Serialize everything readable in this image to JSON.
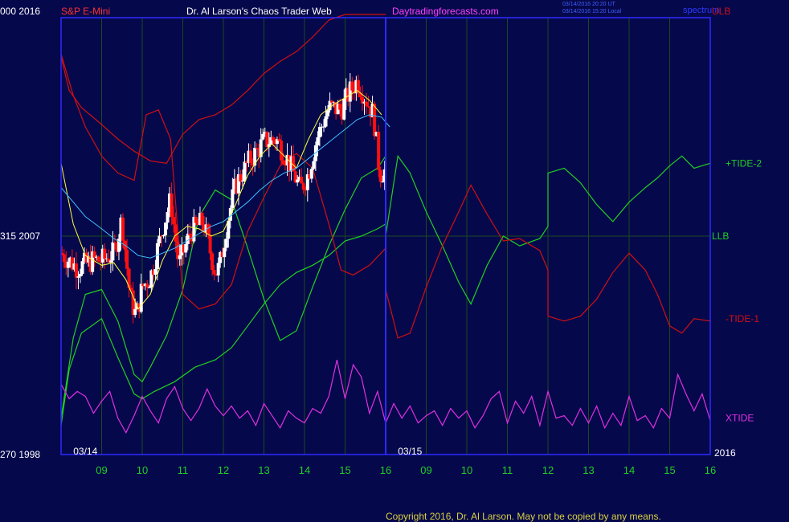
{
  "header": {
    "symbol": "S&P E-Mini",
    "author": "Dr. Al Larson's Chaos Trader Web",
    "site": "Daytradingforecasts.com",
    "timestamp_ut": "03/14/2016 20:20 UT",
    "timestamp_local": "03/14/2016 15:20 Local",
    "watermark": "spectrum",
    "corner_left": "000 2016"
  },
  "left_axis": [
    {
      "value": 2016,
      "label": "000  2016"
    },
    {
      "value": 2007,
      "label": "315  2007"
    },
    {
      "value": 1998,
      "label": "270  1998"
    }
  ],
  "right_axis_year": "2016",
  "date_labels": [
    {
      "label": "03/14",
      "x": 8.5
    },
    {
      "label": "03/15",
      "x": 16.5
    }
  ],
  "footer": {
    "copyright": "Copyright 2016, Dr. Al Larson. May not be copied by any means."
  },
  "colors": {
    "background": "#06084c",
    "frame": "#2b2bff",
    "grid": "#1b4a1b",
    "price_up": "#ffffff",
    "price_down": "#ff1010",
    "ma_fast": "#ffff40",
    "ma_slow": "#40c0ff",
    "green_line": "#20d020",
    "red_line": "#d01010",
    "xtide": "#e030e0",
    "title_red": "#ff3030",
    "title_white": "#ffffff",
    "title_magenta": "#ff40ff",
    "axis_text": "#ffffff",
    "hour_labels": "#20d020"
  },
  "chart_data": {
    "type": "line",
    "title": "S&P E-Mini",
    "xlabel": "",
    "ylabel": "",
    "ylim": [
      1998,
      2016
    ],
    "xlim": [
      8,
      16
    ],
    "x_ticks": [
      {
        "x": 9,
        "label": "09"
      },
      {
        "x": 10,
        "label": "10"
      },
      {
        "x": 11,
        "label": "11"
      },
      {
        "x": 12,
        "label": "12"
      },
      {
        "x": 13,
        "label": "13"
      },
      {
        "x": 14,
        "label": "14"
      },
      {
        "x": 15,
        "label": "15"
      },
      {
        "x": 16,
        "label": "16"
      },
      {
        "x": 17,
        "label": "09"
      },
      {
        "x": 18,
        "label": "10"
      },
      {
        "x": 19,
        "label": "11"
      },
      {
        "x": 20,
        "label": "12"
      },
      {
        "x": 21,
        "label": "13"
      },
      {
        "x": 22,
        "label": "14"
      },
      {
        "x": 23,
        "label": "15"
      },
      {
        "x": 24,
        "label": "16"
      }
    ],
    "day_divider_x": 16.0,
    "grid": true,
    "series": [
      {
        "name": "+TIDE-2",
        "color": "#20d020",
        "x": [
          16.0,
          16.3,
          16.6,
          17.0,
          17.4,
          17.8,
          18.1,
          18.5,
          18.9,
          19.3,
          19.8,
          20.0,
          20.0,
          20.4,
          20.8,
          21.2,
          21.6,
          22.0,
          22.4,
          22.7,
          23.0,
          23.3,
          23.6,
          24.0
        ],
        "y": [
          2007.0,
          2010.3,
          2009.6,
          2008.0,
          2006.6,
          2005.1,
          2004.2,
          2005.8,
          2007.0,
          2006.6,
          2006.9,
          2007.4,
          2009.6,
          2009.8,
          2009.2,
          2008.3,
          2007.6,
          2008.4,
          2009.0,
          2009.4,
          2009.9,
          2010.3,
          2009.8,
          2010.0
        ]
      },
      {
        "name": "-TIDE-1",
        "color": "#d01010",
        "x": [
          16.0,
          16.0,
          16.3,
          16.6,
          17.0,
          17.4,
          17.8,
          18.1,
          18.5,
          18.9,
          19.3,
          19.8,
          20.0,
          20.0,
          20.4,
          20.8,
          21.2,
          21.6,
          22.0,
          22.4,
          22.7,
          23.0,
          23.3,
          23.6,
          24.0
        ],
        "y": [
          2006.2,
          2004.8,
          2002.8,
          2003.0,
          2004.9,
          2006.6,
          2008.0,
          2009.1,
          2007.9,
          2006.8,
          2006.9,
          2006.4,
          2005.6,
          2003.7,
          2003.5,
          2003.7,
          2004.4,
          2005.5,
          2006.3,
          2005.6,
          2004.6,
          2003.3,
          2003.0,
          2003.6,
          2003.5
        ]
      },
      {
        "name": "LLB",
        "color": "#20d020",
        "x": [
          8.0,
          8.3,
          8.6,
          9.0,
          9.4,
          9.8,
          10.0,
          10.2,
          10.6,
          11.0,
          11.4,
          11.8,
          12.2,
          12.6,
          13.0,
          13.4,
          13.8,
          14.2,
          14.6,
          15.0,
          15.4,
          15.8,
          16.0
        ],
        "y": [
          1999.5,
          2002.8,
          2004.6,
          2004.8,
          2003.5,
          2001.3,
          2001.0,
          2001.6,
          2002.9,
          2004.8,
          2007.8,
          2008.9,
          2008.5,
          2006.5,
          2004.4,
          2002.7,
          2003.1,
          2004.9,
          2006.6,
          2008.1,
          2009.4,
          2009.8,
          2010.3
        ]
      },
      {
        "name": "LLB",
        "color": "#20d020",
        "x": [
          8.0,
          8.2,
          8.5,
          9.0,
          9.4,
          9.8,
          10.0,
          10.3,
          10.8,
          11.3,
          11.8,
          12.2,
          12.6,
          13.0,
          13.4,
          13.8,
          14.2,
          14.6,
          15.0,
          15.4,
          15.8,
          16.0
        ],
        "y": [
          1999.2,
          2001.5,
          2003.0,
          2003.6,
          2002.0,
          2000.5,
          2000.3,
          2000.6,
          2001.0,
          2001.6,
          2001.9,
          2002.4,
          2003.3,
          2004.2,
          2005.0,
          2005.5,
          2005.8,
          2006.2,
          2006.8,
          2007.0,
          2007.3,
          2007.5
        ]
      },
      {
        "name": "ULB",
        "color": "#d01010",
        "x": [
          8.0,
          8.2,
          8.5,
          9.0,
          9.4,
          9.8,
          10.2,
          10.6,
          11.0,
          11.4,
          11.8,
          12.2,
          12.6,
          13.0,
          13.4,
          13.8,
          14.2,
          14.6,
          15.0,
          15.4,
          15.8,
          16.0
        ],
        "y": [
          2014.4,
          2013.0,
          2012.3,
          2011.6,
          2011.0,
          2010.5,
          2010.1,
          2010.0,
          2011.2,
          2011.8,
          2012.0,
          2012.4,
          2013.0,
          2013.7,
          2014.2,
          2014.6,
          2015.2,
          2015.9,
          2016.4,
          2017.2,
          2017.8,
          2018.3
        ]
      },
      {
        "name": "ULB",
        "color": "#d01010",
        "x": [
          8.0,
          8.3,
          8.6,
          9.0,
          9.4,
          9.8,
          10.1,
          10.4,
          10.7,
          11.0,
          11.4,
          11.8,
          12.2,
          12.6,
          13.0,
          13.4,
          13.8,
          14.2,
          14.6,
          14.9,
          15.2,
          15.6,
          16.0
        ],
        "y": [
          2014.5,
          2012.8,
          2011.5,
          2010.3,
          2009.6,
          2009.3,
          2012.0,
          2012.2,
          2011.0,
          2004.6,
          2004.0,
          2004.2,
          2005.0,
          2007.2,
          2008.6,
          2009.9,
          2010.4,
          2009.8,
          2007.5,
          2005.6,
          2005.4,
          2005.8,
          2006.5
        ]
      },
      {
        "name": "Moving Average",
        "color": "#ffff40",
        "x": [
          8.0,
          8.3,
          8.6,
          9.0,
          9.3,
          9.6,
          9.9,
          10.2,
          10.5,
          10.8,
          11.1,
          11.4,
          11.7,
          12.0,
          12.3,
          12.6,
          12.9,
          13.2,
          13.5,
          13.8,
          14.1,
          14.4,
          14.7,
          15.0,
          15.3,
          15.6,
          15.9
        ],
        "y": [
          2010.0,
          2007.5,
          2006.2,
          2005.8,
          2005.9,
          2005.2,
          2004.0,
          2004.6,
          2006.0,
          2007.0,
          2007.4,
          2007.3,
          2007.0,
          2007.2,
          2008.3,
          2009.5,
          2010.3,
          2010.8,
          2010.3,
          2009.8,
          2011.0,
          2012.0,
          2012.4,
          2012.7,
          2013.0,
          2012.6,
          2012.0
        ]
      },
      {
        "name": "Moving Average",
        "color": "#40c0ff",
        "x": [
          8.0,
          8.3,
          8.6,
          9.0,
          9.3,
          9.6,
          9.9,
          10.2,
          10.5,
          10.8,
          11.1,
          11.4,
          11.7,
          12.0,
          12.3,
          12.6,
          12.9,
          13.2,
          13.5,
          13.8,
          14.1,
          14.4,
          14.7,
          15.0,
          15.3,
          15.6,
          15.9,
          16.1
        ],
        "y": [
          2009.0,
          2008.4,
          2007.8,
          2007.3,
          2006.9,
          2006.6,
          2006.2,
          2006.1,
          2006.3,
          2006.5,
          2006.8,
          2007.1,
          2007.4,
          2007.6,
          2008.0,
          2008.4,
          2008.9,
          2009.3,
          2009.6,
          2009.8,
          2010.2,
          2010.6,
          2011.0,
          2011.4,
          2011.8,
          2012.0,
          2011.9,
          2011.5
        ]
      }
    ],
    "xtide": {
      "name": "XTIDE",
      "color": "#e030e0",
      "x": [
        8.0,
        8.2,
        8.4,
        8.6,
        8.8,
        9.0,
        9.2,
        9.4,
        9.6,
        9.8,
        10.0,
        10.2,
        10.4,
        10.6,
        10.8,
        11.0,
        11.2,
        11.4,
        11.6,
        11.8,
        12.0,
        12.2,
        12.4,
        12.6,
        12.8,
        13.0,
        13.2,
        13.4,
        13.6,
        13.8,
        14.0,
        14.2,
        14.4,
        14.6,
        14.8,
        15.0,
        15.2,
        15.4,
        15.6,
        15.8,
        16.0,
        16.2,
        16.4,
        16.6,
        16.8,
        17.0,
        17.2,
        17.4,
        17.6,
        17.8,
        18.0,
        18.2,
        18.4,
        18.6,
        18.8,
        19.0,
        19.2,
        19.4,
        19.6,
        19.8,
        20.0,
        20.2,
        20.4,
        20.6,
        20.8,
        21.0,
        21.2,
        21.4,
        21.6,
        21.8,
        22.0,
        22.2,
        22.4,
        22.6,
        22.8,
        23.0,
        23.2,
        23.4,
        23.6,
        23.8,
        24.0
      ],
      "y": [
        2000.9,
        2000.3,
        2000.6,
        2000.4,
        1999.7,
        2000.2,
        2000.6,
        1999.5,
        1998.9,
        1999.6,
        2000.4,
        1999.8,
        1999.3,
        2000.3,
        2000.8,
        1999.9,
        1999.4,
        1999.9,
        2000.7,
        2000.0,
        1999.6,
        2000.0,
        1999.5,
        1999.8,
        1999.2,
        2000.1,
        1999.6,
        1999.1,
        1999.8,
        1999.5,
        1999.3,
        1999.9,
        1999.7,
        2000.4,
        2001.9,
        2000.3,
        2001.7,
        2001.2,
        1999.7,
        2000.6,
        1999.3,
        2000.1,
        1999.5,
        2000.0,
        1999.3,
        1999.6,
        1999.8,
        1999.2,
        1999.9,
        1999.5,
        1999.8,
        1999.1,
        1999.6,
        2000.3,
        2000.6,
        1999.3,
        2000.2,
        1999.7,
        2000.4,
        1999.2,
        2000.6,
        1999.5,
        1999.6,
        1999.2,
        1999.9,
        1999.3,
        2000.0,
        1999.1,
        1999.7,
        1999.2,
        2000.4,
        1999.4,
        1999.6,
        1999.1,
        1999.9,
        1999.5,
        2001.3,
        2000.5,
        1999.8,
        2000.5,
        1999.4
      ]
    },
    "candles": {
      "x_start": 8.0,
      "x_end": 16.0,
      "count": 160,
      "closes_keypoints": {
        "x": [
          8.0,
          8.4,
          8.8,
          9.0,
          9.3,
          9.5,
          9.7,
          9.85,
          10.0,
          10.2,
          10.5,
          10.7,
          10.9,
          11.2,
          11.5,
          11.8,
          11.9,
          12.1,
          12.3,
          12.6,
          13.0,
          13.3,
          13.6,
          13.9,
          14.1,
          14.3,
          14.6,
          14.9,
          15.1,
          15.3,
          15.5,
          15.7,
          15.85,
          16.0
        ],
        "y": [
          2006.3,
          2005.7,
          2006.0,
          2006.0,
          2006.3,
          2007.7,
          2004.5,
          2003.7,
          2004.9,
          2005.3,
          2007.3,
          2008.5,
          2005.8,
          2007.2,
          2007.6,
          2005.5,
          2005.7,
          2007.6,
          2009.1,
          2010.0,
          2010.9,
          2011.0,
          2010.1,
          2008.9,
          2009.6,
          2011.0,
          2012.3,
          2012.2,
          2012.9,
          2013.4,
          2012.7,
          2012.0,
          2009.6,
          2009.7
        ]
      }
    },
    "legend": [
      {
        "label": "ULB",
        "color": "#d01010",
        "y": 2016
      },
      {
        "label": "+TIDE-2",
        "color": "#20d020",
        "y": 2010.0
      },
      {
        "label": "LLB",
        "color": "#20d020",
        "y": 2007.0
      },
      {
        "label": "-TIDE-1",
        "color": "#d01010",
        "y": 2003.6
      },
      {
        "label": "XTIDE",
        "color": "#e030e0",
        "y": 1999.5
      }
    ]
  }
}
